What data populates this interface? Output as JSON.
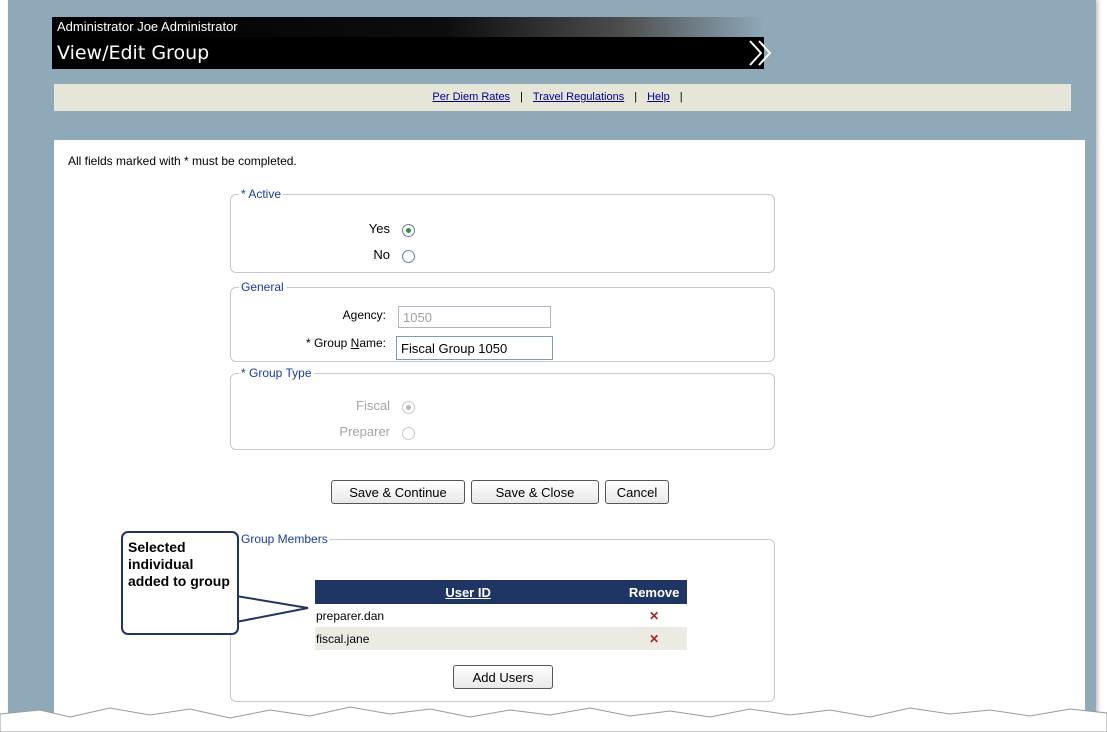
{
  "header": {
    "user": "Administrator Joe Administrator",
    "title": "View/Edit Group"
  },
  "nav": {
    "links": [
      "Per Diem Rates",
      "Travel Regulations",
      "Help"
    ],
    "separator": "|"
  },
  "instructions": "All fields marked with * must be completed.",
  "active": {
    "legend": "* Active",
    "yes_label": "Yes",
    "no_label": "No",
    "selected": "Yes"
  },
  "general": {
    "legend": "General",
    "agency_label": "Agency:",
    "agency_value": "1050",
    "group_name_label_prefix": "* Group ",
    "group_name_label_accel": "N",
    "group_name_label_suffix": "ame:",
    "group_name_value": "Fiscal Group 1050"
  },
  "group_type": {
    "legend": "* Group Type",
    "fiscal_label": "Fiscal",
    "preparer_label": "Preparer",
    "selected": "Fiscal"
  },
  "buttons": {
    "save_continue": "Save & Continue",
    "save_close": "Save & Close",
    "cancel": "Cancel",
    "add_users": "Add Users"
  },
  "members": {
    "legend": "Group Members",
    "columns": [
      "User ID",
      "Remove"
    ],
    "rows": [
      {
        "user_id": "preparer.dan",
        "remove": "✕"
      },
      {
        "user_id": "fiscal.jane",
        "remove": "✕"
      }
    ]
  },
  "callout": {
    "text": "Selected individual added to group"
  },
  "colors": {
    "frame_bg": "#8fa9b9",
    "nav_bg": "#e5e5d8",
    "table_header": "#1f3664",
    "remove_x": "#b02020"
  }
}
